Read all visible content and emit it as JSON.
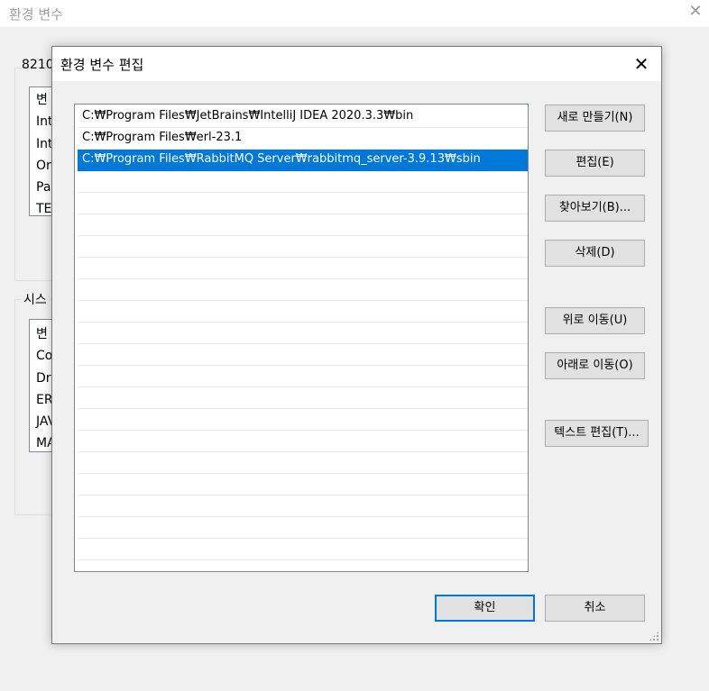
{
  "background_window": {
    "title": "환경 변수",
    "user_section_label_fragment": "8210",
    "user_list_header_fragment": "변",
    "user_list_items": [
      "Int",
      "Int",
      "On",
      "Pa",
      "TE"
    ],
    "system_section_label_fragment": "시스",
    "system_list_header_fragment": "변",
    "system_list_items": [
      "Co",
      "Dr",
      "ER",
      "JAV",
      "MA"
    ]
  },
  "dialog": {
    "title": "환경 변수 편집",
    "paths": [
      "C:₩Program Files₩JetBrains₩IntelliJ IDEA 2020.3.3₩bin",
      "C:₩Program Files₩erl-23.1",
      "C:₩Program Files₩RabbitMQ Server₩rabbitmq_server-3.9.13₩sbin"
    ],
    "selected_index": 2,
    "buttons": {
      "new": "새로 만들기(N)",
      "edit": "편집(E)",
      "browse": "찾아보기(B)...",
      "delete": "삭제(D)",
      "move_up": "위로 이동(U)",
      "move_down": "아래로 이동(O)",
      "edit_text": "텍스트 편집(T)..."
    },
    "ok": "확인",
    "cancel": "취소"
  },
  "icons": {
    "close": "close-icon",
    "resize": "resize-grip-icon"
  },
  "colors": {
    "selection": "#0078d7",
    "default_button_border": "#0078d7",
    "button_face": "#e1e1e1"
  }
}
